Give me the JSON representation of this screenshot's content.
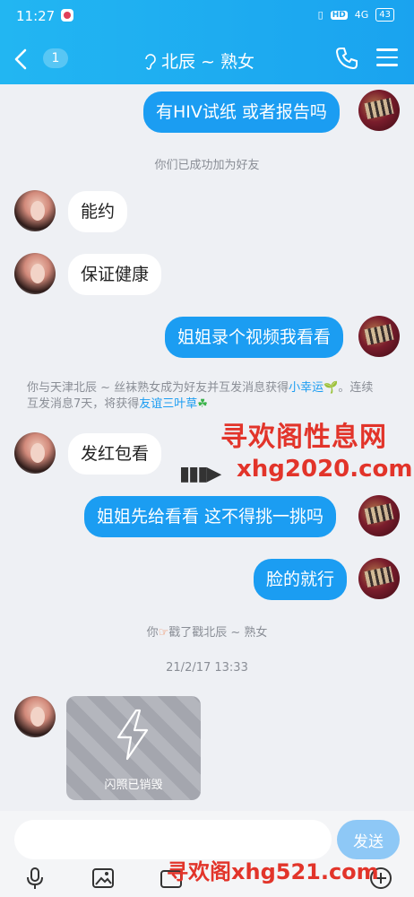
{
  "status": {
    "time": "11:27",
    "hd": "HD",
    "net": "4G",
    "battery": "43"
  },
  "header": {
    "back_count": "1",
    "title": "北辰 ~ 熟女"
  },
  "messages": {
    "m1": "有HIV试纸  或者报告吗",
    "sys1": "你们已成功加为好友",
    "m2": "能约",
    "m3": "保证健康",
    "m4": "姐姐录个视频我看看",
    "sys2_line1_a": "你与天津北辰 ~ 丝袜熟女成为好友并互发消息获得",
    "sys2_link1": "小幸运",
    "sys2_line1_b": "。连续",
    "sys2_line2_a": "互发消息7天，将获得",
    "sys2_link2": "友谊三叶草",
    "m5": "发红包看",
    "m6": "姐姐先给看看  这不得挑一挑吗",
    "m7": "脸的就行",
    "sys3_a": "你",
    "sys3_b": "戳了戳北辰 ~ 熟女",
    "timestamp": "21/2/17 13:33",
    "flash_label": "闪照已销毁"
  },
  "watermarks": {
    "w1": "寻欢阁性息网",
    "w2": "xhg2020.com",
    "w3": "寻欢阁xhg521.com"
  },
  "input": {
    "placeholder": "",
    "send_label": "发送"
  },
  "colors": {
    "header": "#1aa3ef",
    "bubble_out": "#1b9df2",
    "link": "#1b9df2",
    "watermark": "#e2342a"
  }
}
